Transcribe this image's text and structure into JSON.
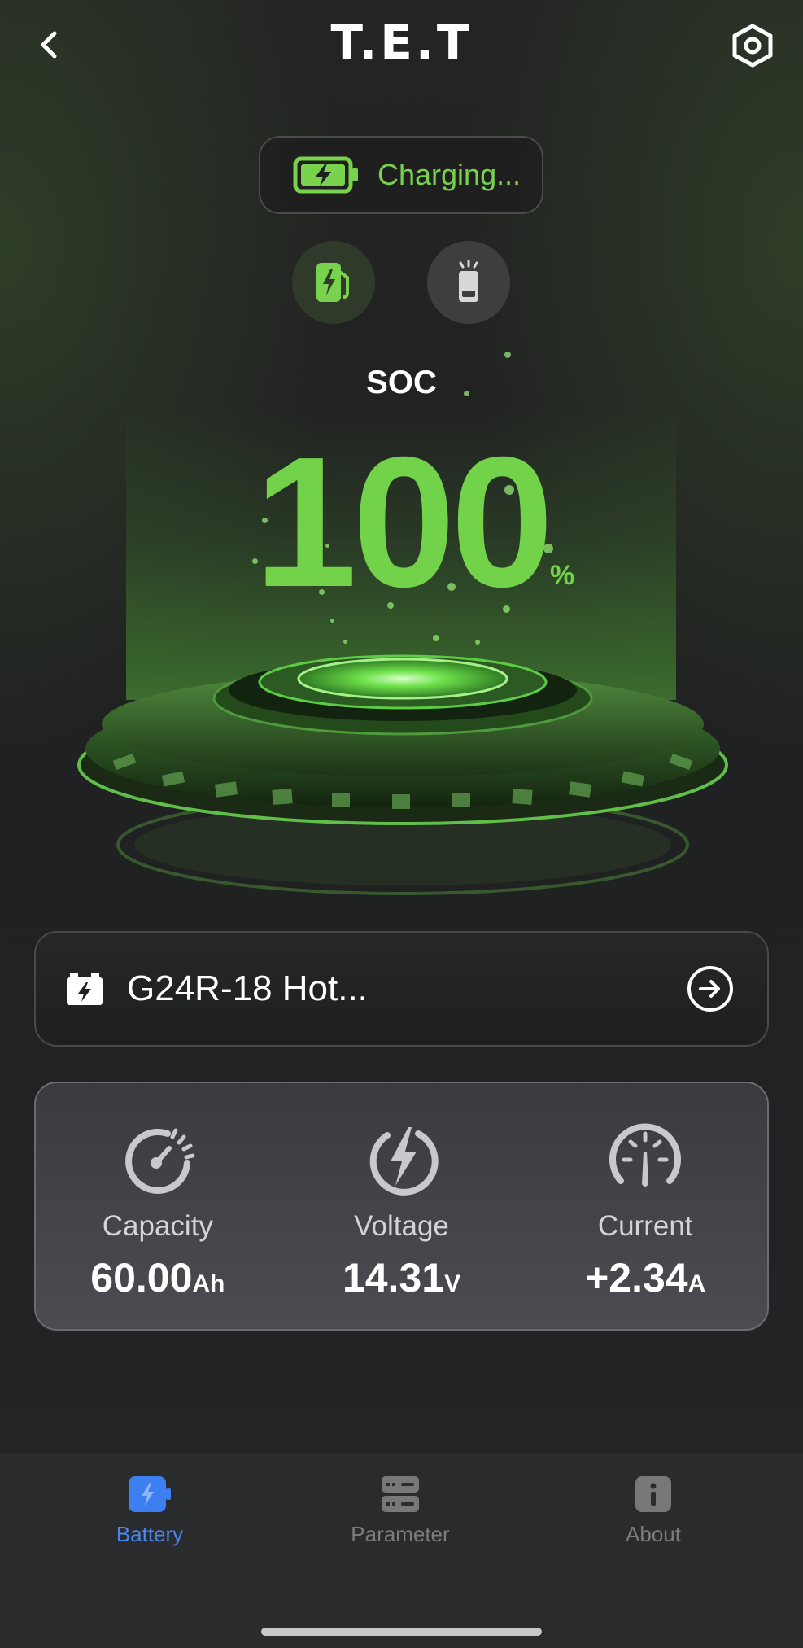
{
  "header": {
    "logo": "T.E.T"
  },
  "status": {
    "label": "Charging...",
    "color": "#79d24d"
  },
  "soc": {
    "label": "SOC",
    "value": "100",
    "unit": "%"
  },
  "device": {
    "name": "G24R-18 Hot..."
  },
  "metrics": [
    {
      "label": "Capacity",
      "value": "60.00",
      "unit": "Ah",
      "icon": "speedometer-icon"
    },
    {
      "label": "Voltage",
      "value": "14.31",
      "unit": "V",
      "icon": "bolt-circle-icon"
    },
    {
      "label": "Current",
      "value": "+2.34",
      "unit": "A",
      "icon": "gauge-icon"
    }
  ],
  "nav": {
    "items": [
      {
        "label": "Battery",
        "icon": "battery-icon",
        "active": true
      },
      {
        "label": "Parameter",
        "icon": "server-icon",
        "active": false
      },
      {
        "label": "About",
        "icon": "info-icon",
        "active": false
      }
    ]
  },
  "colors": {
    "accent_green": "#72d24a",
    "active_blue": "#4a86f0",
    "inactive_gray": "#7b7c7e"
  }
}
